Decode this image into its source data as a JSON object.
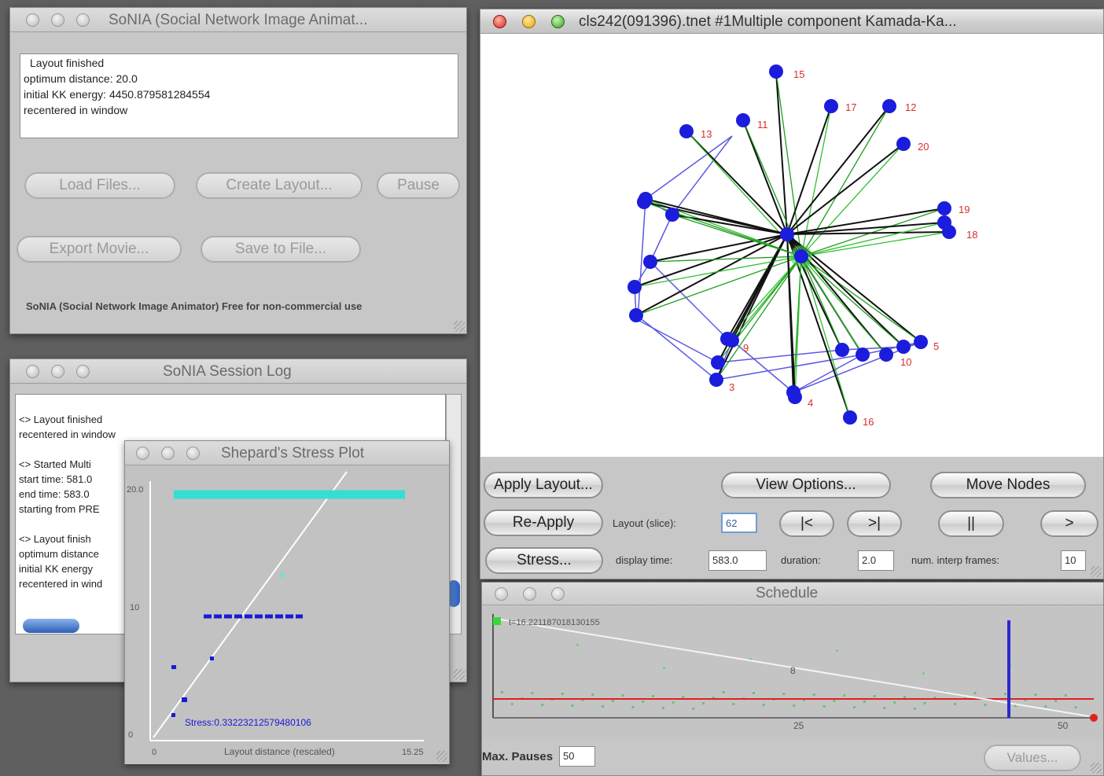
{
  "main_window": {
    "title": "SoNIA (Social Network Image Animat...",
    "status_lines": [
      "Layout finished",
      "optimum distance: 20.0",
      "initial KK energy: 4450.879581284554",
      "recentered in window"
    ],
    "buttons": {
      "load_files": "Load Files...",
      "create_layout": "Create Layout...",
      "pause": "Pause",
      "export_movie": "Export Movie...",
      "save_to_file": "Save to File..."
    },
    "footer": "SoNIA (Social Network Image Animator) Free for non-commercial use"
  },
  "log_window": {
    "title": "SoNIA Session Log",
    "lines": [
      "<> Layout finished",
      "recentered in window",
      "",
      "<> Started Multi",
      "start time: 581.0",
      "end time: 583.0",
      "starting from PRE",
      "",
      "<> Layout finish",
      "optimum distance",
      "initial KK energy",
      "recentered in wind"
    ]
  },
  "stress_window": {
    "title": "Shepard's Stress Plot",
    "y_ticks": [
      "20.0",
      "10",
      "0"
    ],
    "x_ticks": [
      "0",
      "15.25"
    ],
    "x_label": "Layout distance (rescaled)",
    "stress_label": "Stress:0.33223212579480106"
  },
  "network_window": {
    "title": "cls242(091396).tnet #1Multiple component Kamada-Ka...",
    "node_labels": [
      "15",
      "17",
      "12",
      "13",
      "11",
      "20",
      "19",
      "18",
      "5",
      "10",
      "4",
      "16",
      "3",
      "9"
    ],
    "controls": {
      "apply_layout": "Apply Layout...",
      "view_options": "View Options...",
      "move_nodes": "Move Nodes",
      "re_apply": "Re-Apply",
      "layout_slice_label": "Layout (slice):",
      "layout_slice_value": "62",
      "step_back": "|<",
      "step_forward": ">|",
      "pause": "||",
      "play": ">",
      "stress": "Stress...",
      "display_time_label": "display time:",
      "display_time_value": "583.0",
      "duration_label": "duration:",
      "duration_value": "2.0",
      "interp_label": "num. interp frames:",
      "interp_value": "10"
    }
  },
  "schedule_window": {
    "title": "Schedule",
    "top_label": "t=16.221187018130155",
    "mid_label": "8",
    "x_ticks": [
      "25",
      "50"
    ],
    "max_pauses_label": "Max. Pauses",
    "max_pauses_value": "50",
    "values_button": "Values..."
  }
}
